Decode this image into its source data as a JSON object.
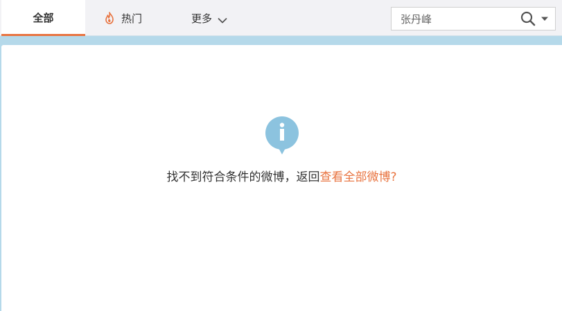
{
  "tabs": {
    "all_label": "全部",
    "hot_label": "热门",
    "more_label": "更多"
  },
  "search": {
    "value": "张丹峰",
    "placeholder": "张丹峰"
  },
  "empty_state": {
    "message": "找不到符合条件的微博，返回",
    "link_label": "查看全部微博?"
  },
  "icons": {
    "hot": "flame-icon",
    "more": "chevron-down-icon",
    "search": "magnifier-icon",
    "search_dropdown": "caret-down-icon",
    "empty": "info-icon"
  },
  "colors": {
    "accent": "#e8733f",
    "info_icon": "#8cc3df",
    "frame_border": "#b5d9ea"
  }
}
